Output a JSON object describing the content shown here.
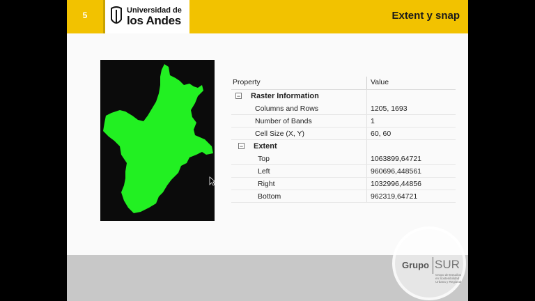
{
  "slide": {
    "page_number": "5",
    "title": "Extent y snap",
    "logo": {
      "line1": "Universidad de",
      "line2": "los Andes"
    }
  },
  "properties": {
    "header": {
      "property": "Property",
      "value": "Value"
    },
    "raster_information": {
      "label": "Raster Information",
      "toggle": "−",
      "rows": [
        {
          "key": "Columns and Rows",
          "value": "1205, 1693"
        },
        {
          "key": "Number of Bands",
          "value": "1"
        },
        {
          "key": "Cell Size (X, Y)",
          "value": "60, 60"
        }
      ]
    },
    "extent": {
      "label": "Extent",
      "toggle": "−",
      "rows": [
        {
          "key": "Top",
          "value": "1063899,64721"
        },
        {
          "key": "Left",
          "value": "960696,448561"
        },
        {
          "key": "Right",
          "value": "1032996,44856"
        },
        {
          "key": "Bottom",
          "value": "962319,64721"
        }
      ]
    }
  },
  "watermark": {
    "left": "Grupo",
    "right": "SUR",
    "sub": "Grupo de Estudios en Sostenibilidad Urbana y Regional"
  },
  "colors": {
    "header": "#f2c200",
    "raster_fill": "#22f022",
    "raster_bg": "#0b0b0b",
    "footer": "#c8c8c8"
  }
}
